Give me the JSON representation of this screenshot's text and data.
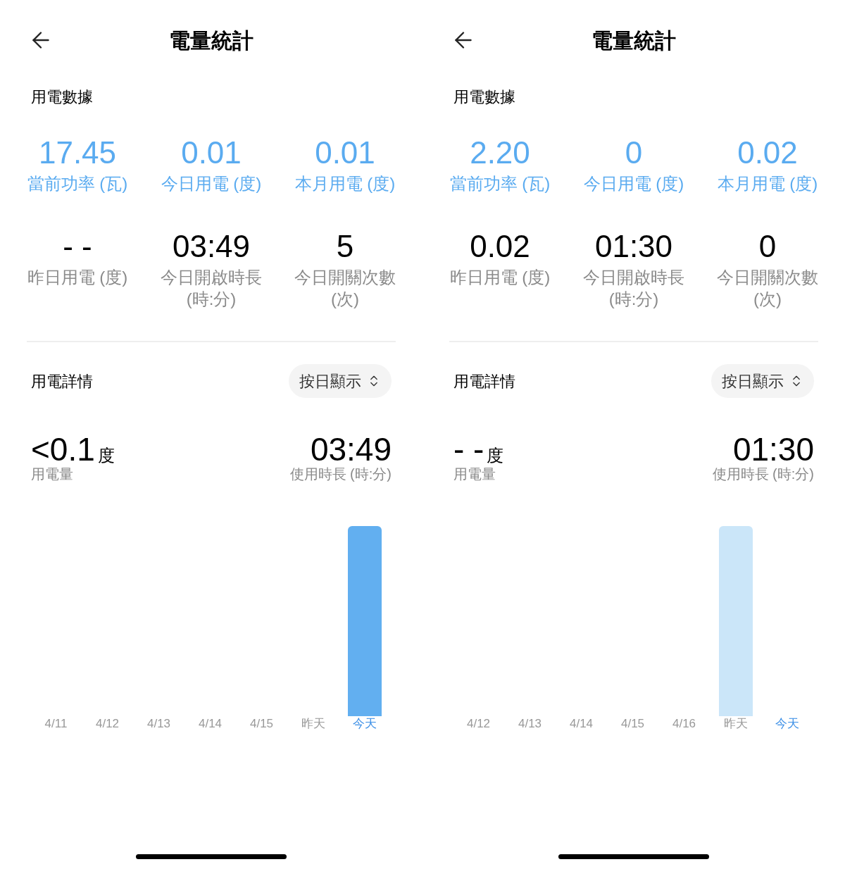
{
  "screens": [
    {
      "title": "電量統計",
      "data_section": {
        "title": "用電數據",
        "primary_stats": [
          {
            "value": "17.45",
            "label": "當前功率 (瓦)"
          },
          {
            "value": "0.01",
            "label": "今日用電 (度)"
          },
          {
            "value": "0.01",
            "label": "本月用電 (度)"
          }
        ],
        "secondary_stats": [
          {
            "value": "- -",
            "label": "昨日用電 (度)"
          },
          {
            "value": "03:49",
            "label": "今日開啟時長 (時:分)"
          },
          {
            "value": "5",
            "label": "今日開關次數 (次)"
          }
        ]
      },
      "detail_section": {
        "title": "用電詳情",
        "view_button": "按日顯示",
        "usage": {
          "value": "<0.1",
          "unit": "度",
          "label": "用電量"
        },
        "duration": {
          "value": "03:49",
          "label": "使用時長 (時:分)"
        },
        "days": [
          {
            "label": "4/11",
            "selected": false,
            "has_bar": false
          },
          {
            "label": "4/12",
            "selected": false,
            "has_bar": false
          },
          {
            "label": "4/13",
            "selected": false,
            "has_bar": false
          },
          {
            "label": "4/14",
            "selected": false,
            "has_bar": false
          },
          {
            "label": "4/15",
            "selected": false,
            "has_bar": false
          },
          {
            "label": "昨天",
            "selected": false,
            "has_bar": false
          },
          {
            "label": "今天",
            "selected": true,
            "has_bar": true
          }
        ]
      }
    },
    {
      "title": "電量統計",
      "data_section": {
        "title": "用電數據",
        "primary_stats": [
          {
            "value": "2.20",
            "label": "當前功率 (瓦)"
          },
          {
            "value": "0",
            "label": "今日用電 (度)"
          },
          {
            "value": "0.02",
            "label": "本月用電 (度)"
          }
        ],
        "secondary_stats": [
          {
            "value": "0.02",
            "label": "昨日用電 (度)"
          },
          {
            "value": "01:30",
            "label": "今日開啟時長 (時:分)"
          },
          {
            "value": "0",
            "label": "今日開關次數 (次)"
          }
        ]
      },
      "detail_section": {
        "title": "用電詳情",
        "view_button": "按日顯示",
        "usage": {
          "value": "- -",
          "unit": "度",
          "label": "用電量"
        },
        "duration": {
          "value": "01:30",
          "label": "使用時長 (時:分)"
        },
        "days": [
          {
            "label": "4/12",
            "selected": false,
            "has_bar": false
          },
          {
            "label": "4/13",
            "selected": false,
            "has_bar": false
          },
          {
            "label": "4/14",
            "selected": false,
            "has_bar": false
          },
          {
            "label": "4/15",
            "selected": false,
            "has_bar": false
          },
          {
            "label": "4/16",
            "selected": false,
            "has_bar": false
          },
          {
            "label": "昨天",
            "selected": false,
            "has_bar": true
          },
          {
            "label": "今天",
            "selected": true,
            "has_bar": false
          }
        ]
      }
    }
  ]
}
